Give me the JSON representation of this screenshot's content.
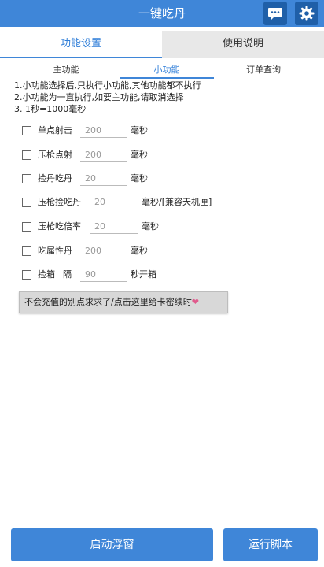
{
  "header": {
    "title": "一键吃丹",
    "chat_icon": "chat-icon",
    "settings_icon": "gear-icon"
  },
  "tabs": [
    {
      "label": "功能设置",
      "active": true
    },
    {
      "label": "使用说明",
      "active": false
    }
  ],
  "subtabs": [
    {
      "label": "主功能"
    },
    {
      "label": "小功能",
      "active": true
    },
    {
      "label": "订单查询"
    }
  ],
  "info_lines": [
    "1.小功能选择后,只执行小功能,其他功能都不执行",
    "2.小功能为一直执行,如要主功能,请取消选择",
    "3.  1秒=1000毫秒"
  ],
  "options": [
    {
      "label": "单点射击",
      "value": "200",
      "unit": "毫秒"
    },
    {
      "label": "压枪点射",
      "value": "200",
      "unit": "毫秒"
    },
    {
      "label": "捡丹吃丹",
      "value": "20",
      "unit": "毫秒"
    },
    {
      "label": "压枪捡吃丹",
      "value": "20",
      "unit": "毫秒/[兼容天机匣]"
    },
    {
      "label": "压枪吃倍率",
      "value": "20",
      "unit": "毫秒"
    },
    {
      "label": "吃属性丹",
      "value": "200",
      "unit": "毫秒"
    },
    {
      "label": "捡箱",
      "label_extra": "隔",
      "value": "90",
      "unit": "秒开箱"
    }
  ],
  "banner": {
    "text": "不会充值的别点求求了/点击这里给卡密续时",
    "heart": "❤"
  },
  "buttons": {
    "float_window": "启动浮窗",
    "run_script": "运行脚本"
  },
  "colors": {
    "primary": "#3f86d8",
    "dark_icon_bg": "#1f5fa8"
  }
}
